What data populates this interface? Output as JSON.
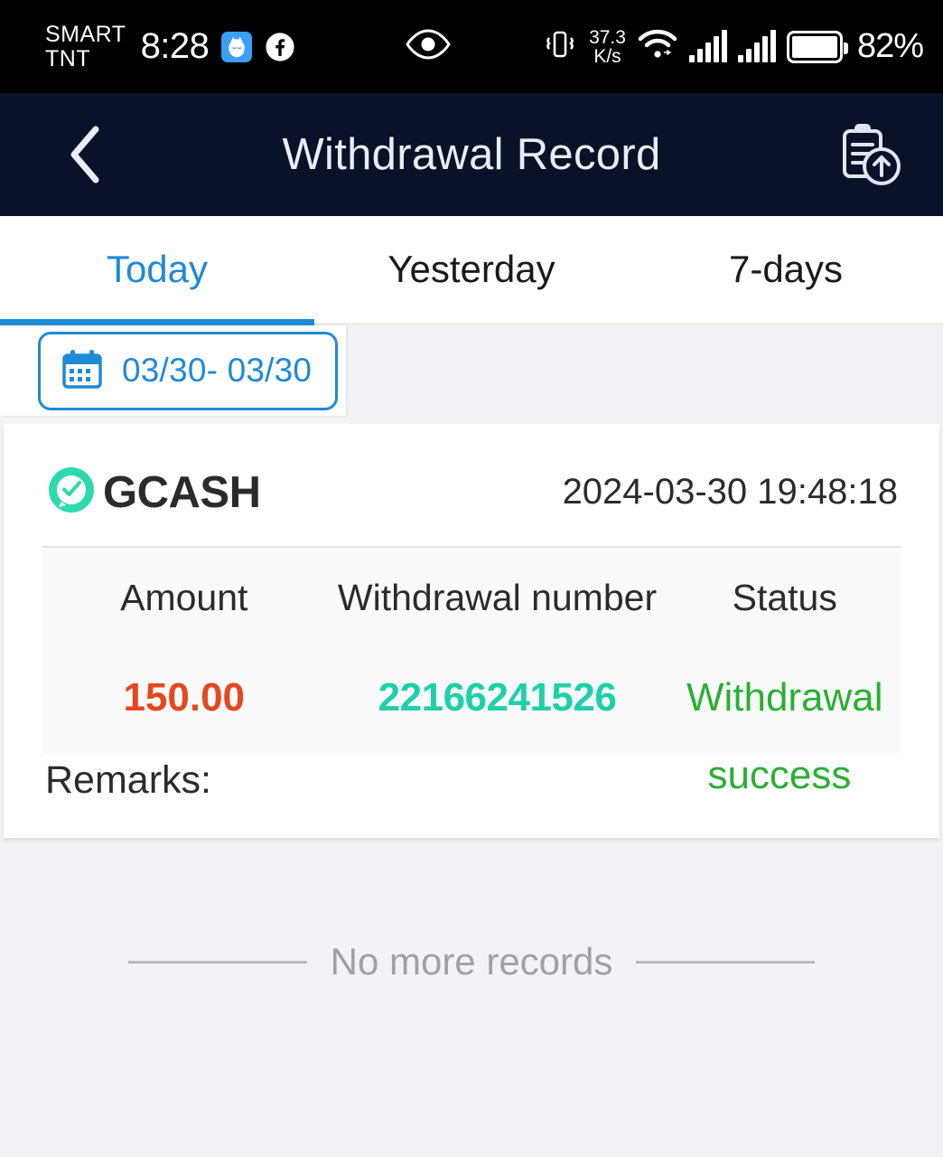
{
  "statusbar": {
    "carrier": "SMART\nTNT",
    "time": "8:28",
    "app_icon": "chat-app-icon",
    "facebook_icon": "facebook-icon",
    "eye_icon": "eye-icon",
    "vibrate_icon": "vibrate-icon",
    "network_speed": "37.3\nK/s",
    "wifi_icon": "wifi-icon",
    "signal_icon_1": "signal-bars-icon",
    "signal_icon_2": "signal-bars-icon",
    "battery_icon": "battery-icon",
    "battery_percent": "82%"
  },
  "header": {
    "back_icon": "chevron-left-icon",
    "title": "Withdrawal Record",
    "action_icon": "clipboard-upload-icon"
  },
  "tabs": [
    {
      "label": "Today",
      "active": true
    },
    {
      "label": "Yesterday",
      "active": false
    },
    {
      "label": "7-days",
      "active": false
    }
  ],
  "filter": {
    "calendar_icon": "calendar-icon",
    "date_range": "03/30- 03/30"
  },
  "record": {
    "brand_icon": "gcash-logo-icon",
    "brand_name": "GCASH",
    "timestamp": "2024-03-30 19:48:18",
    "columns": [
      "Amount",
      "Withdrawal number",
      "Status"
    ],
    "amount": "150.00",
    "withdrawal_number": "22166241526",
    "status": "Withdrawal success",
    "status_line_1": "Withdrawal",
    "status_line_2": "success",
    "remarks_label": "Remarks:"
  },
  "footer": {
    "no_more_text": "No more records"
  },
  "colors": {
    "header_bg": "#0a1229",
    "accent_blue": "#2089d8",
    "amount_red": "#e4481e",
    "number_teal": "#1ed0a9",
    "status_green": "#2ab033",
    "page_bg": "#f3f3f7",
    "gcash_green": "#2fd9ae"
  }
}
